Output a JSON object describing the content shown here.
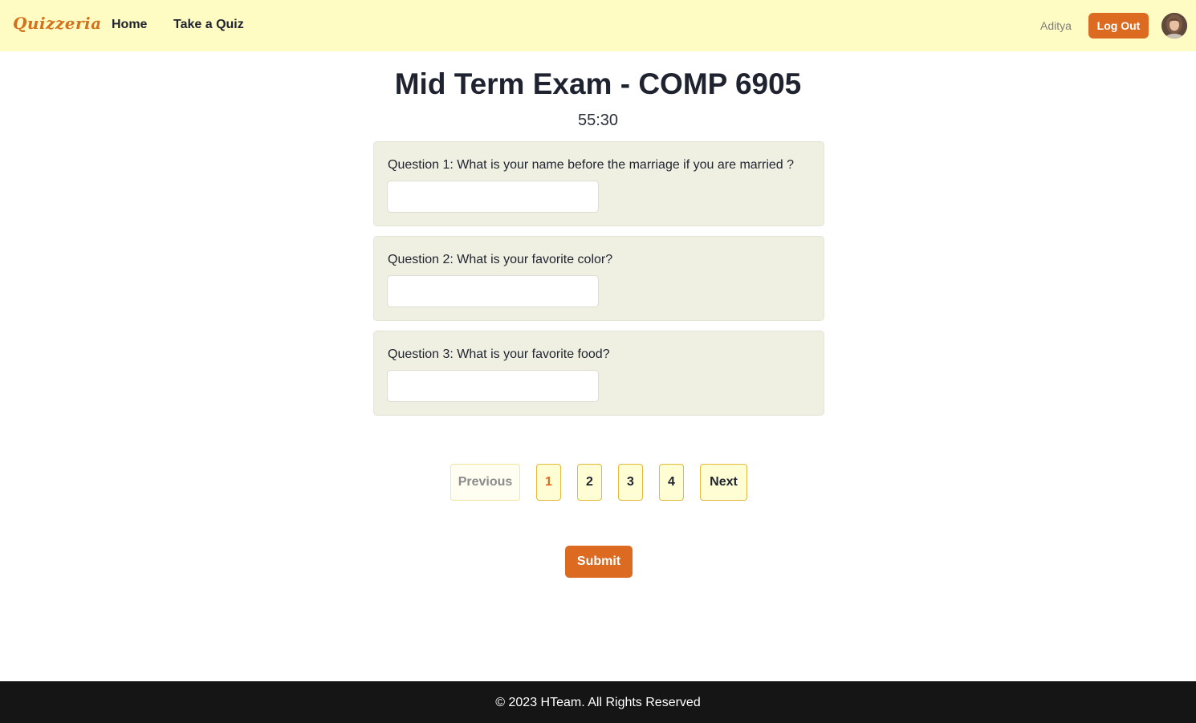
{
  "navbar": {
    "brand": "Quizzeria",
    "links": [
      {
        "label": "Home"
      },
      {
        "label": "Take a Quiz"
      }
    ],
    "username": "Aditya",
    "logout_label": "Log Out",
    "avatar_icon": "user-avatar-icon"
  },
  "exam": {
    "title": "Mid Term Exam - COMP 6905",
    "timer": "55:30",
    "questions": [
      {
        "text": "Question 1: What is your name before the marriage if you are married ?",
        "answer": ""
      },
      {
        "text": "Question 2: What is your favorite color?",
        "answer": ""
      },
      {
        "text": "Question 3: What is your favorite food?",
        "answer": ""
      }
    ]
  },
  "pagination": {
    "previous_label": "Previous",
    "pages": [
      "1",
      "2",
      "3",
      "4"
    ],
    "current_page": "1",
    "next_label": "Next"
  },
  "submit_label": "Submit",
  "footer": {
    "text": "© 2023 HTeam. All Rights Reserved"
  },
  "colors": {
    "navbar_bg": "#fefcc2",
    "brand": "#d4711e",
    "accent": "#dc6b21",
    "card_bg": "#f0f0e2",
    "footer_bg": "#151515"
  }
}
